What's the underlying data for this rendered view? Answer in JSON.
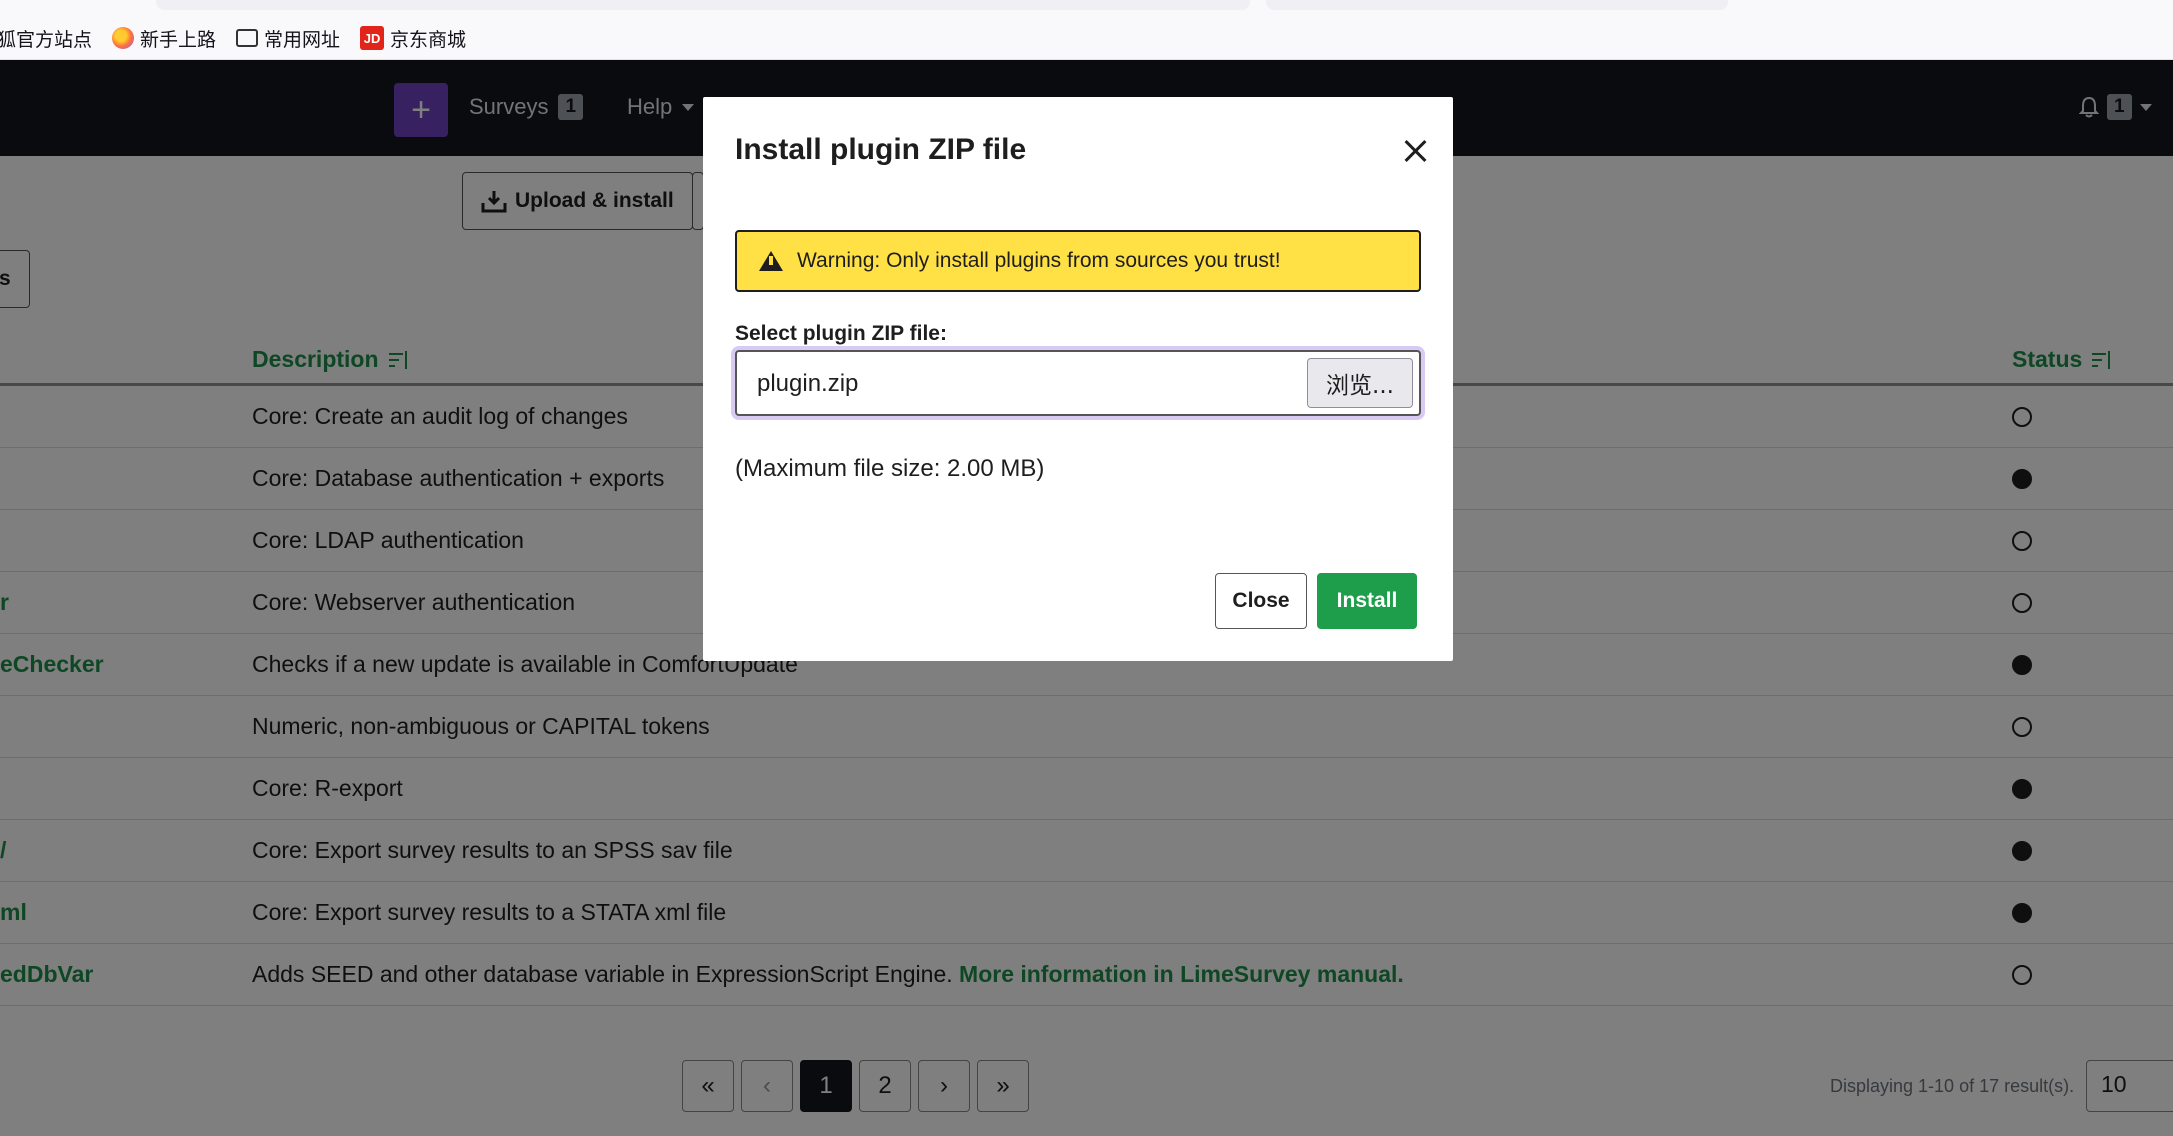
{
  "browser": {
    "bookmarks": [
      {
        "label": "火狐官方站点",
        "icon": "globe-icon"
      },
      {
        "label": "新手上路",
        "icon": "firefox-icon"
      },
      {
        "label": "常用网址",
        "icon": "folder-icon"
      },
      {
        "label": "京东商城",
        "icon": "jd-icon",
        "icon_text": "JD"
      }
    ]
  },
  "navbar": {
    "add_label": "+",
    "surveys_label": "Surveys",
    "surveys_count": "1",
    "help_label": "Help",
    "notifications_count": "1"
  },
  "toolbar": {
    "upload_install_label": "Upload & install"
  },
  "table": {
    "headers": {
      "description": "Description",
      "status": "Status"
    },
    "rows": [
      {
        "name": "",
        "description": "Core: Create an audit log of changes",
        "link": "",
        "active": false
      },
      {
        "name": "",
        "description": "Core: Database authentication + exports",
        "link": "",
        "active": true
      },
      {
        "name": "",
        "description": "Core: LDAP authentication",
        "link": "",
        "active": false
      },
      {
        "name": "r",
        "description": "Core: Webserver authentication",
        "link": "",
        "active": false
      },
      {
        "name": "eChecker",
        "description": "Checks if a new update is available in ComfortUpdate",
        "link": "",
        "active": true
      },
      {
        "name": "",
        "description": "Numeric, non-ambiguous or CAPITAL tokens",
        "link": "",
        "active": false
      },
      {
        "name": "",
        "description": "Core: R-export",
        "link": "",
        "active": true
      },
      {
        "name": "/",
        "description": "Core: Export survey results to an SPSS sav file",
        "link": "",
        "active": true
      },
      {
        "name": "ml",
        "description": "Core: Export survey results to a STATA xml file",
        "link": "",
        "active": true
      },
      {
        "name": "edDbVar",
        "description": "Adds SEED and other database variable in ExpressionScript Engine.",
        "link": "More information in LimeSurvey manual.",
        "active": false
      }
    ]
  },
  "pagination": {
    "first": "«",
    "prev": "‹",
    "pages": [
      "1",
      "2"
    ],
    "next": "›",
    "last": "»",
    "info": "Displaying 1-10 of 17 result(s).",
    "page_size": "10"
  },
  "modal": {
    "title": "Install plugin ZIP file",
    "warning": "Warning: Only install plugins from sources you trust!",
    "file_label": "Select plugin ZIP file:",
    "file_value": "plugin.zip",
    "browse_label": "浏览...",
    "max_size": "(Maximum file size: 2.00 MB)",
    "close_label": "Close",
    "install_label": "Install"
  },
  "colors": {
    "accent": "#1e8e4a",
    "navbar": "#14161f",
    "add_button": "#6f42c1",
    "warning": "#ffe045",
    "install": "#1e9e4a"
  }
}
